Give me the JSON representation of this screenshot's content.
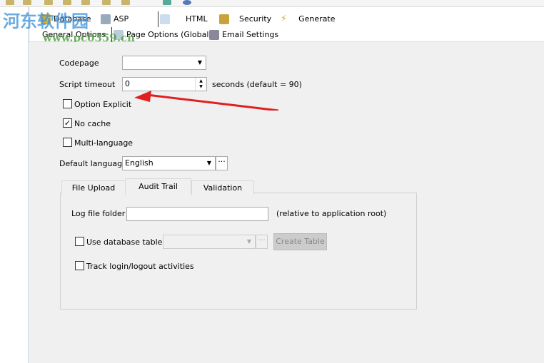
{
  "watermark": {
    "title": "河东软件园",
    "url": "www.pc0359.cn"
  },
  "main_tabs": [
    {
      "label": "Database"
    },
    {
      "label": "ASP"
    },
    {
      "label": "HTML"
    },
    {
      "label": "Security"
    },
    {
      "label": "Generate"
    }
  ],
  "sub_tabs": [
    {
      "label": "General Options"
    },
    {
      "label": "Page Options (Global)"
    },
    {
      "label": "Email Settings"
    }
  ],
  "form": {
    "codepage_label": "Codepage",
    "codepage_value": "",
    "script_timeout_label": "Script timeout",
    "script_timeout_value": "0",
    "script_timeout_hint": "seconds (default = 90)",
    "option_explicit": {
      "label": "Option Explicit",
      "checked": false
    },
    "no_cache": {
      "label": "No cache",
      "checked": true
    },
    "multi_language": {
      "label": "Multi-language",
      "checked": false
    },
    "default_language_label": "Default language",
    "default_language_value": "English"
  },
  "inner_tabs": [
    {
      "label": "File Upload"
    },
    {
      "label": "Audit Trail",
      "active": true
    },
    {
      "label": "Validation"
    }
  ],
  "audit": {
    "log_folder_label": "Log file folder",
    "log_folder_value": "",
    "log_folder_hint": "(relative to application root)",
    "use_db_table": {
      "label": "Use database table",
      "checked": false
    },
    "create_table_label": "Create Table",
    "track_login": {
      "label": "Track login/logout activities",
      "checked": false
    }
  },
  "annotation": {
    "arrow_color": "#e02020"
  }
}
